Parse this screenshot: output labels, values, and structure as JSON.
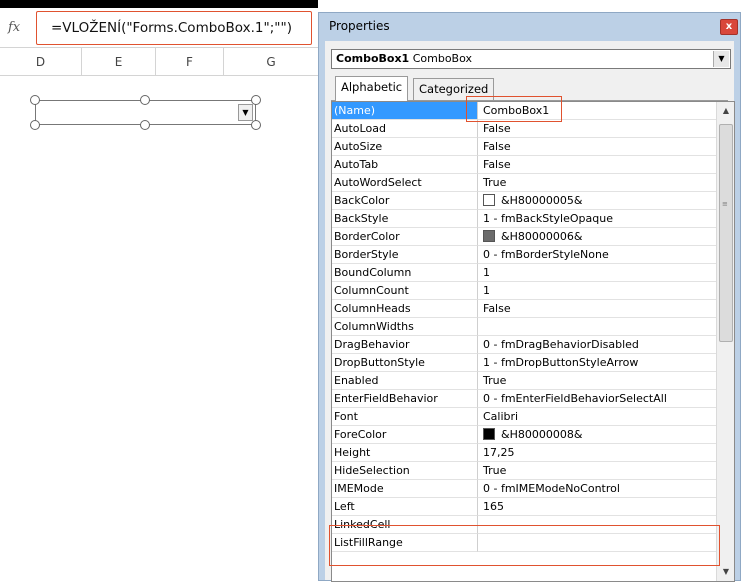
{
  "formula_bar": {
    "fx_label": "fx",
    "formula": "=VLOŽENÍ(\"Forms.ComboBox.1\";\"\")"
  },
  "columns": [
    "D",
    "E",
    "F",
    "G"
  ],
  "properties_window": {
    "title": "Properties",
    "close_label": "x",
    "object_name": "ComboBox1",
    "object_type": "ComboBox",
    "tabs": [
      "Alphabetic",
      "Categorized"
    ],
    "rows": [
      {
        "name": "(Name)",
        "value": "ComboBox1"
      },
      {
        "name": "AutoLoad",
        "value": "False"
      },
      {
        "name": "AutoSize",
        "value": "False"
      },
      {
        "name": "AutoTab",
        "value": "False"
      },
      {
        "name": "AutoWordSelect",
        "value": "True"
      },
      {
        "name": "BackColor",
        "value": "&H80000005&",
        "swatch": "#ffffff"
      },
      {
        "name": "BackStyle",
        "value": "1 - fmBackStyleOpaque"
      },
      {
        "name": "BorderColor",
        "value": "&H80000006&",
        "swatch": "#6b6b6b"
      },
      {
        "name": "BorderStyle",
        "value": "0 - fmBorderStyleNone"
      },
      {
        "name": "BoundColumn",
        "value": "1"
      },
      {
        "name": "ColumnCount",
        "value": "1"
      },
      {
        "name": "ColumnHeads",
        "value": "False"
      },
      {
        "name": "ColumnWidths",
        "value": ""
      },
      {
        "name": "DragBehavior",
        "value": "0 - fmDragBehaviorDisabled"
      },
      {
        "name": "DropButtonStyle",
        "value": "1 - fmDropButtonStyleArrow"
      },
      {
        "name": "Enabled",
        "value": "True"
      },
      {
        "name": "EnterFieldBehavior",
        "value": "0 - fmEnterFieldBehaviorSelectAll"
      },
      {
        "name": "Font",
        "value": "Calibri"
      },
      {
        "name": "ForeColor",
        "value": "&H80000008&",
        "swatch": "#000000"
      },
      {
        "name": "Height",
        "value": "17,25"
      },
      {
        "name": "HideSelection",
        "value": "True"
      },
      {
        "name": "IMEMode",
        "value": "0 - fmIMEModeNoControl"
      },
      {
        "name": "Left",
        "value": "165"
      },
      {
        "name": "LinkedCell",
        "value": ""
      },
      {
        "name": "ListFillRange",
        "value": ""
      }
    ]
  },
  "colors": {
    "highlight": "#e0522f",
    "selection": "#3399ff",
    "window_frame": "#bcd0e6"
  }
}
